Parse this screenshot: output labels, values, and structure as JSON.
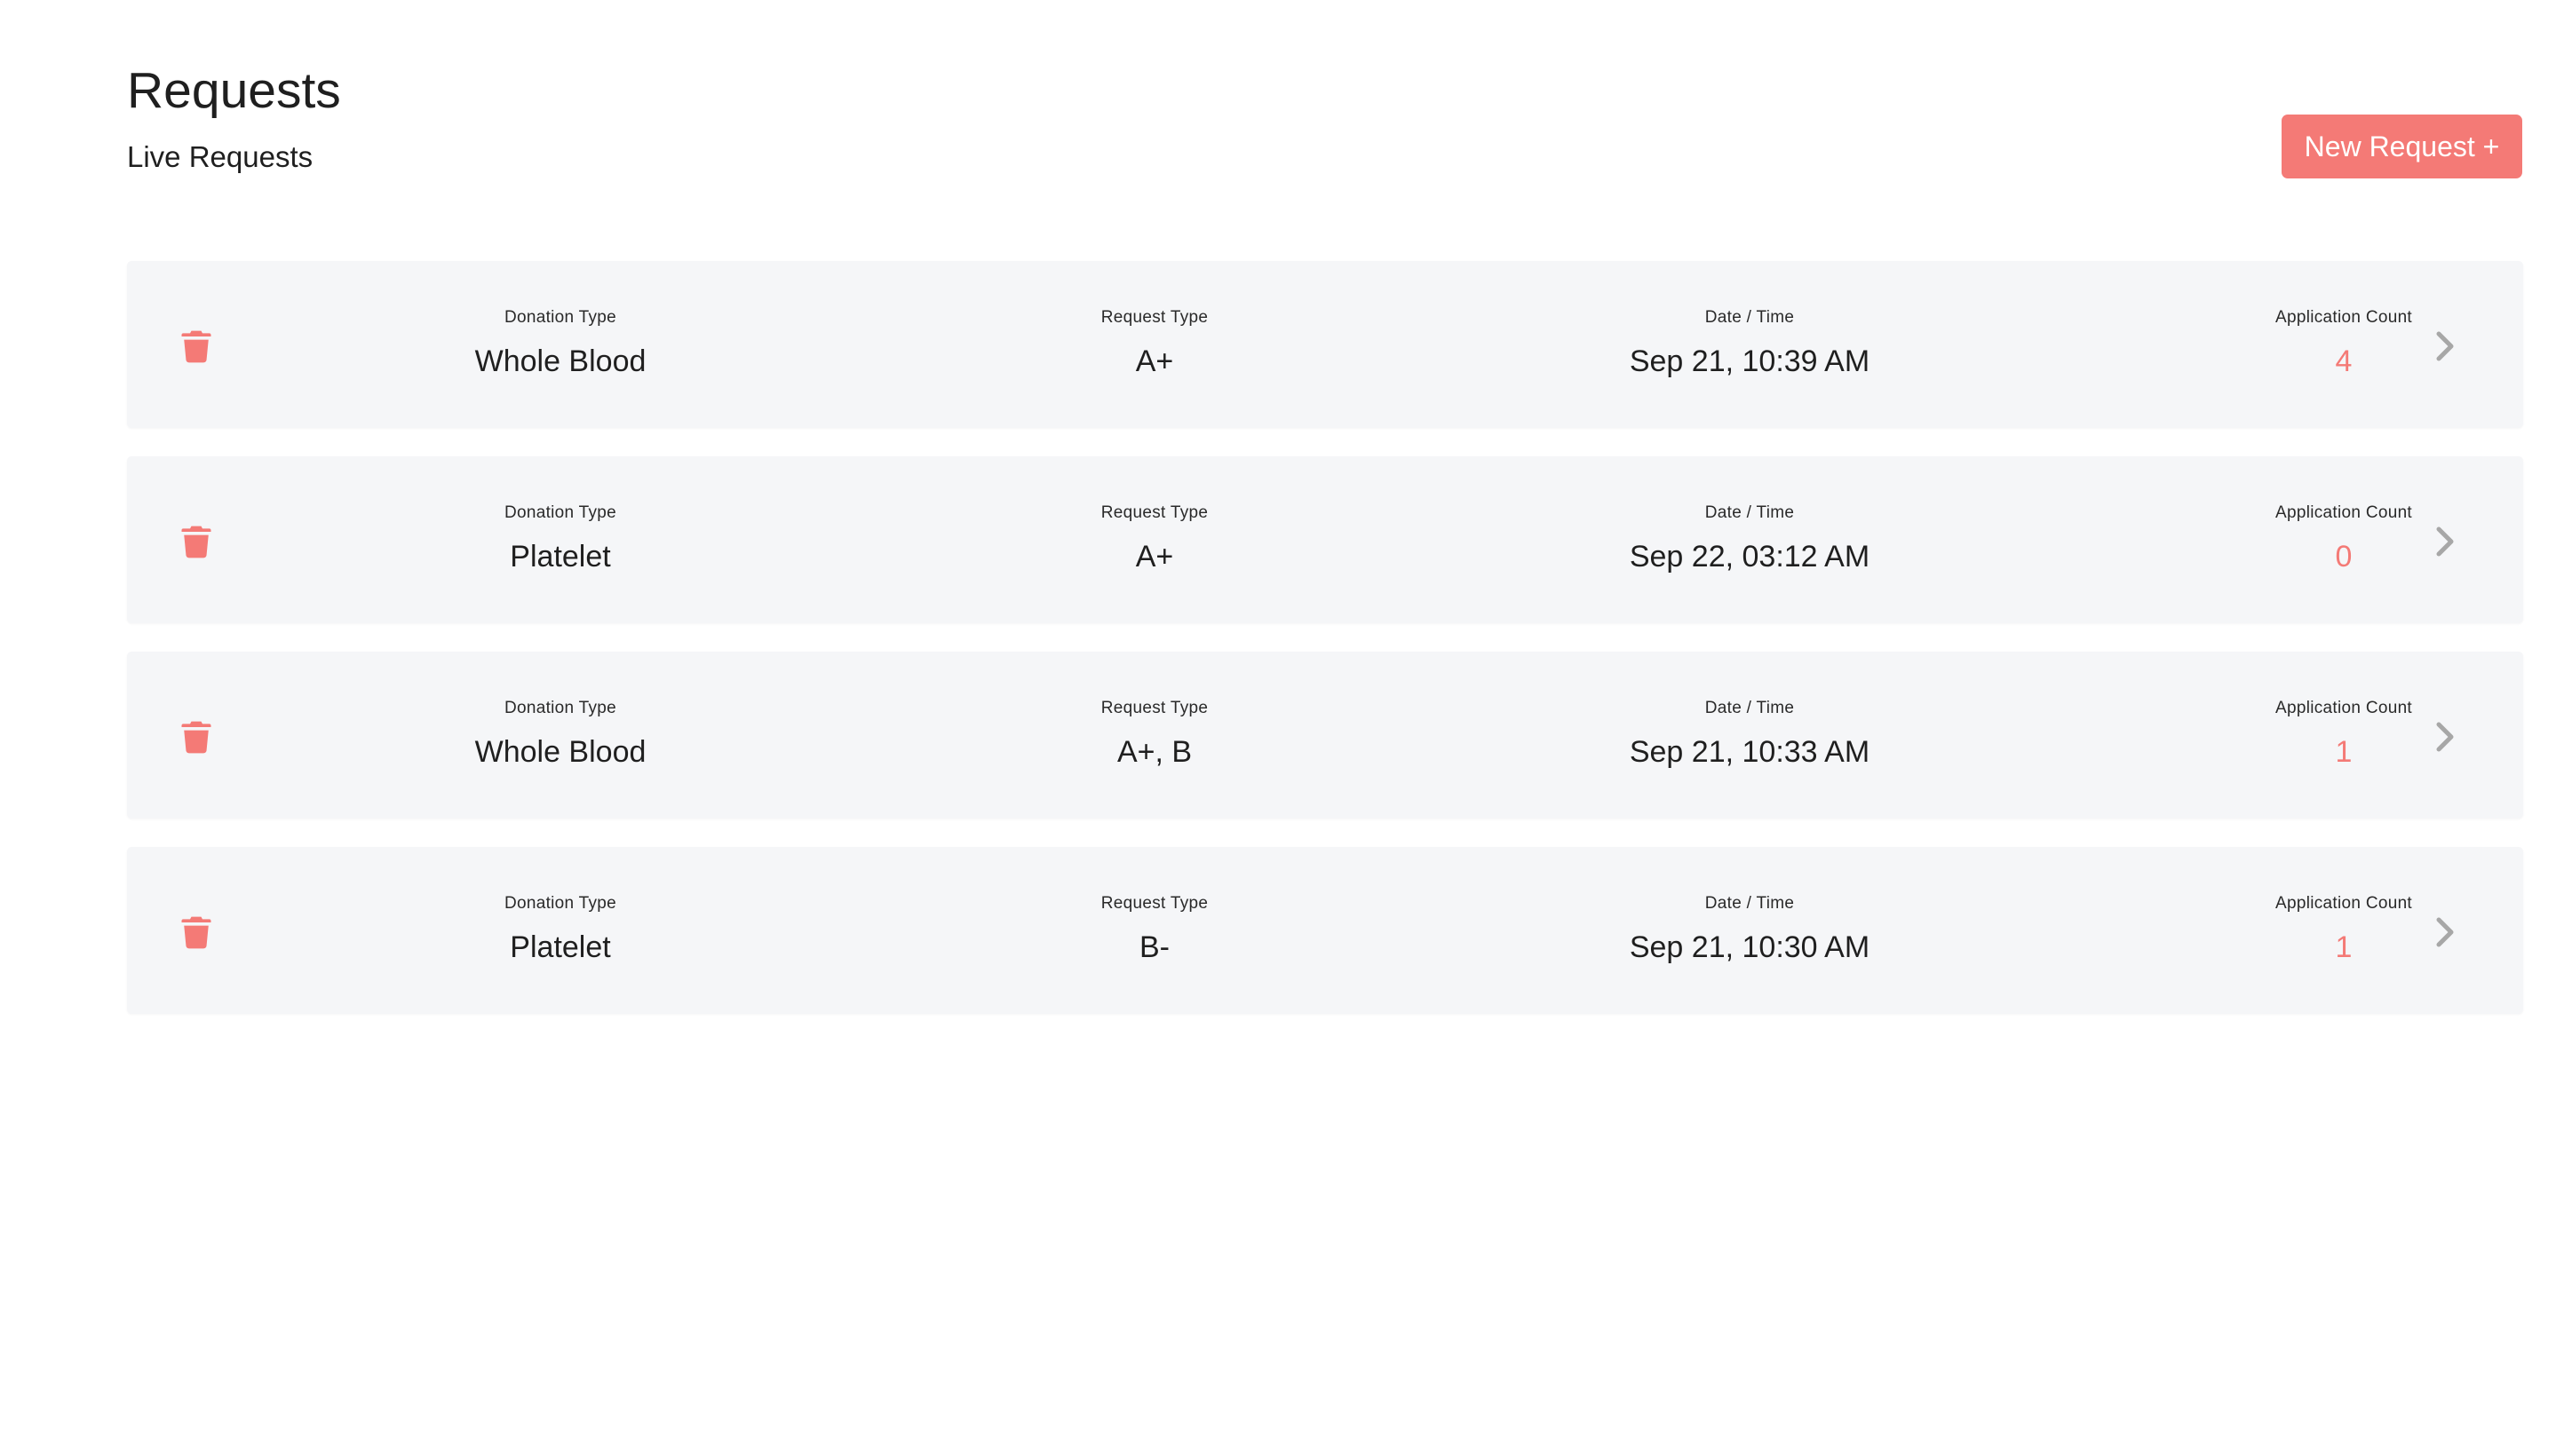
{
  "theme": {
    "accent": "#f47a76",
    "card_background": "#f5f6f8",
    "chevron_color": "#a7a7a7"
  },
  "header": {
    "title": "Requests",
    "subtitle": "Live Requests"
  },
  "actions": {
    "new_request_label": "New Request +"
  },
  "icons": {
    "delete": "trash-icon",
    "open": "chevron-right-icon"
  },
  "requests": [
    {
      "donation_type_label": "Donation Type",
      "donation_type": "Whole Blood",
      "request_type_label": "Request Type",
      "request_type": "A+",
      "datetime_label": "Date / Time",
      "datetime": "Sep 21, 10:39 AM",
      "count_label": "Application Count",
      "count": "4"
    },
    {
      "donation_type_label": "Donation Type",
      "donation_type": "Platelet",
      "request_type_label": "Request Type",
      "request_type": "A+",
      "datetime_label": "Date / Time",
      "datetime": "Sep 22, 03:12 AM",
      "count_label": "Application Count",
      "count": "0"
    },
    {
      "donation_type_label": "Donation Type",
      "donation_type": "Whole Blood",
      "request_type_label": "Request Type",
      "request_type": "A+, B",
      "datetime_label": "Date / Time",
      "datetime": "Sep 21, 10:33 AM",
      "count_label": "Application Count",
      "count": "1"
    },
    {
      "donation_type_label": "Donation Type",
      "donation_type": "Platelet",
      "request_type_label": "Request Type",
      "request_type": "B-",
      "datetime_label": "Date / Time",
      "datetime": "Sep 21, 10:30 AM",
      "count_label": "Application Count",
      "count": "1"
    }
  ]
}
